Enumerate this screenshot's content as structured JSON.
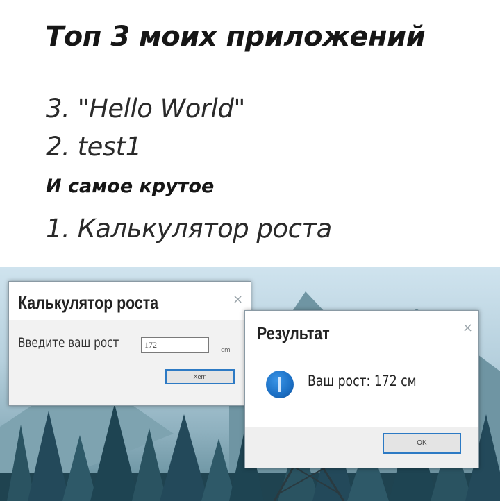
{
  "meme": {
    "title": "Топ 3 моих приложений",
    "item3": "3. \"Hello World\"",
    "item2": "2. test1",
    "subtitle": "И самое крутое",
    "item1": "1. Калькулятор роста"
  },
  "calculator_window": {
    "title": "Калькулятор роста",
    "close_icon": "×",
    "prompt": "Введите ваш рост",
    "height_value": "172",
    "unit": "cm",
    "calc_button": "Хеrn"
  },
  "result_window": {
    "title": "Результат",
    "close_icon": "×",
    "icon": "info-icon",
    "message": "Ваш рост: 172 см",
    "ok_button": "OK"
  }
}
